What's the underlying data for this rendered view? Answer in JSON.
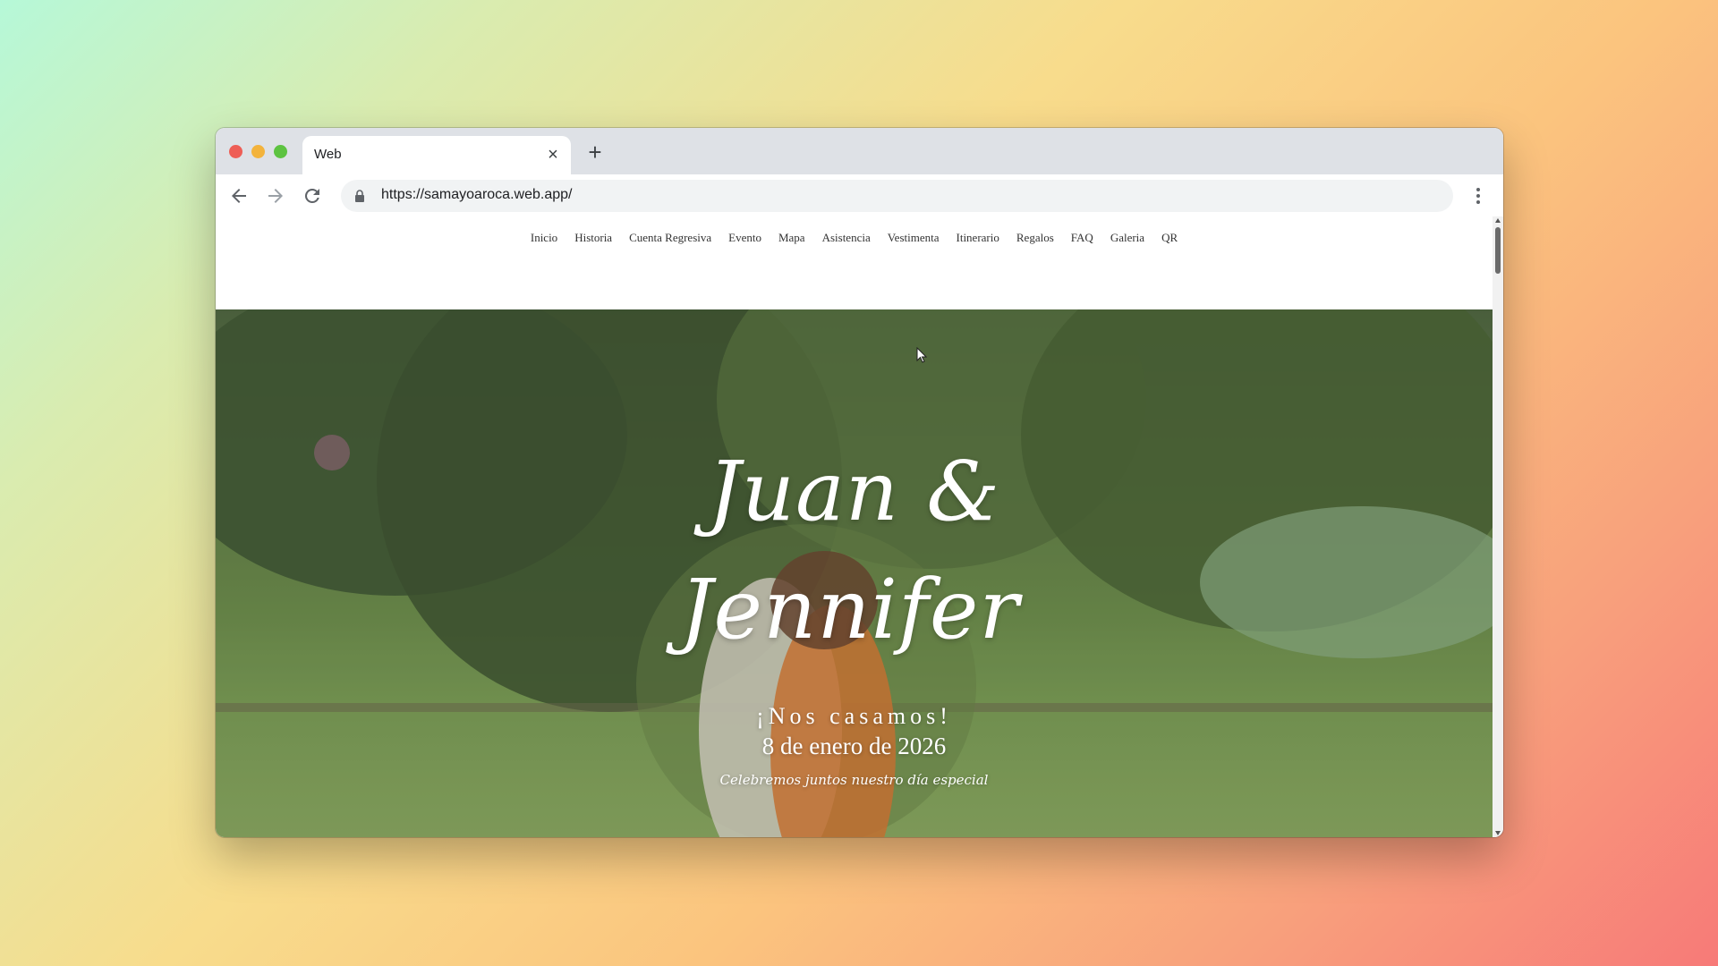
{
  "browser": {
    "tab_title": "Web",
    "tab_close_icon": "×",
    "new_tab_icon": "+",
    "url": "https://samayoaroca.web.app/"
  },
  "site": {
    "nav": [
      "Inicio",
      "Historia",
      "Cuenta Regresiva",
      "Evento",
      "Mapa",
      "Asistencia",
      "Vestimenta",
      "Itinerario",
      "Regalos",
      "FAQ",
      "Galeria",
      "QR"
    ]
  },
  "hero": {
    "line1": "Juan &",
    "line2": "Jennifer",
    "subtitle": "¡Nos casamos!",
    "date": "8 de enero de 2026",
    "tagline": "Celebremos juntos nuestro día especial"
  },
  "icons": {
    "back": "arrow-left-icon",
    "forward": "arrow-right-icon",
    "reload": "reload-icon",
    "lock": "lock-icon",
    "menu": "kebab-menu-icon"
  },
  "colors": {
    "tab_strip": "#dee1e6",
    "omnibox": "#f1f3f4",
    "close": "#ee5e56",
    "minimize": "#f3b33c",
    "zoom": "#5dc341"
  }
}
